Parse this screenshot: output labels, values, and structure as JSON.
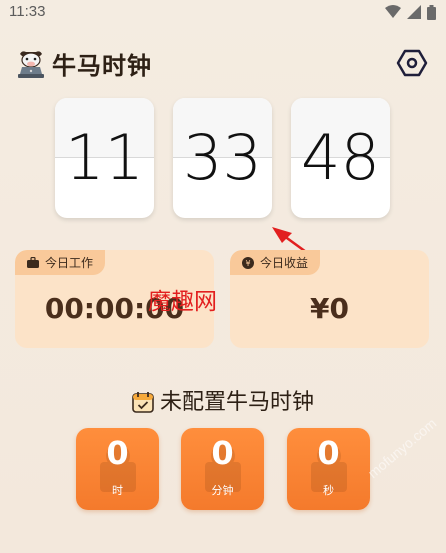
{
  "status": {
    "time": "11:33"
  },
  "header": {
    "title": "牛马时钟",
    "logo_icon": "cow-at-laptop-icon",
    "settings_icon": "hexagon-settings-icon"
  },
  "clock": {
    "hours": "11",
    "minutes": "33",
    "seconds": "48"
  },
  "work_panel": {
    "label": "今日工作",
    "icon": "briefcase-icon",
    "value": "00:00:00"
  },
  "earn_panel": {
    "label": "今日收益",
    "icon": "yen-coin-icon",
    "value": "¥0"
  },
  "overlay": {
    "watermark": "魔趣网",
    "corner_mark": "mofunyo.com"
  },
  "config": {
    "title": "未配置牛马时钟",
    "icon": "calendar-check-icon"
  },
  "units": [
    {
      "value": "0",
      "label": "时"
    },
    {
      "value": "0",
      "label": "分钟"
    },
    {
      "value": "0",
      "label": "秒"
    }
  ],
  "colors": {
    "accent": "#f47a2c",
    "panel": "#fce3c8",
    "tag": "#f9c99a",
    "watermark": "#e21f1f"
  }
}
